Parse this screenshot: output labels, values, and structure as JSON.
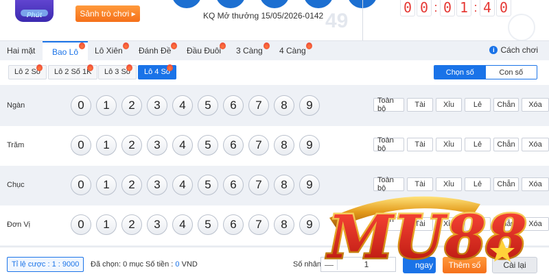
{
  "header": {
    "logo_text": "Phút",
    "lobby_button": "Sảnh trò chơi ▸",
    "result_label": "KQ Mở thưởng 15/05/2026-0142",
    "bg_number": "49",
    "timer": [
      "0",
      "0",
      "0",
      "1",
      "4",
      "0"
    ]
  },
  "tabs": {
    "items": [
      {
        "label": "Hai mặt"
      },
      {
        "label": "Bao Lô"
      },
      {
        "label": "Lô Xiên"
      },
      {
        "label": "Đánh Đề"
      },
      {
        "label": "Đầu Đuôi"
      },
      {
        "label": "3 Càng"
      },
      {
        "label": "4 Càng"
      }
    ],
    "active": "Bao Lô",
    "help_label": "Cách chơi"
  },
  "subtabs": {
    "items": [
      {
        "label": "Lô 2 Số"
      },
      {
        "label": "Lô 2 Số 1K"
      },
      {
        "label": "Lô 3 Số"
      },
      {
        "label": "Lô 4 Số"
      }
    ],
    "active": "Lô 4 Số",
    "mode_select": "Chọn số",
    "mode_input": "Con số"
  },
  "rows": [
    {
      "label": "Ngàn"
    },
    {
      "label": "Trăm"
    },
    {
      "label": "Chục"
    },
    {
      "label": "Đơn Vị"
    }
  ],
  "digits": [
    "0",
    "1",
    "2",
    "3",
    "4",
    "5",
    "6",
    "7",
    "8",
    "9"
  ],
  "quick_buttons": [
    "Toàn bộ",
    "Tài",
    "Xỉu",
    "Lẻ",
    "Chẵn",
    "Xóa"
  ],
  "footer": {
    "rate_label": "Tỉ lệ cược : 1 : 9000",
    "selected_label": "Đã chọn: ",
    "selected_value": "0 mục",
    "amount_label": "Số tiền : ",
    "amount_value": "0",
    "amount_unit": " VND",
    "multiplier_label": "Số nhân :",
    "multiplier_minus": "—",
    "multiplier_value": "1",
    "bet_now": "ngay",
    "add_number": "Thêm số",
    "reset": "Cài lại"
  },
  "watermark": {
    "text": "MU88"
  },
  "colors": {
    "accent": "#1a73e8",
    "orange": "#f5701a",
    "timer": "#e53935"
  }
}
